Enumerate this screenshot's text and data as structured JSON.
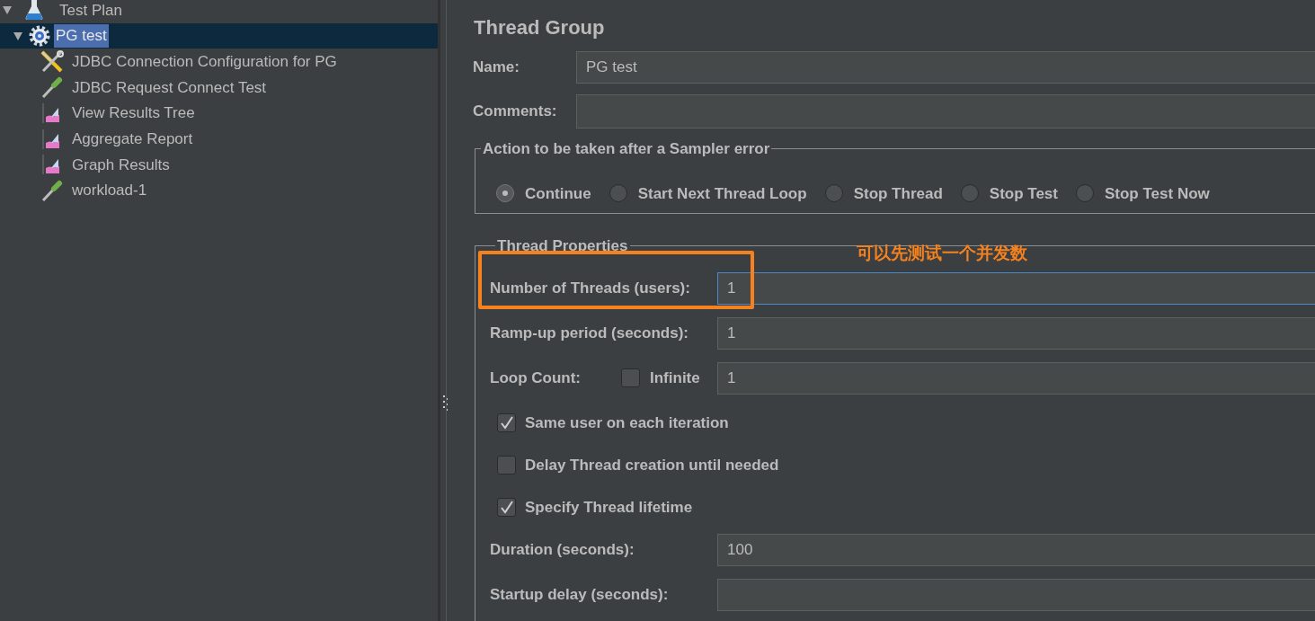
{
  "tree": [
    {
      "label": "Test Plan",
      "kind": "test-plan",
      "expanded": true,
      "selected": false,
      "children": [
        {
          "label": "PG test",
          "kind": "thread-group",
          "expanded": true,
          "selected": true,
          "children": [
            {
              "label": "JDBC Connection Configuration for PG",
              "kind": "config",
              "selected": false
            },
            {
              "label": "JDBC Request Connect Test",
              "kind": "sampler",
              "selected": false
            },
            {
              "label": "View Results Tree",
              "kind": "listener",
              "selected": false
            },
            {
              "label": "Aggregate Report",
              "kind": "listener",
              "selected": false
            },
            {
              "label": "Graph Results",
              "kind": "listener",
              "selected": false
            },
            {
              "label": "workload-1",
              "kind": "sampler",
              "selected": false
            }
          ]
        }
      ]
    }
  ],
  "panel": {
    "title": "Thread Group",
    "name": {
      "label": "Name:",
      "value": "PG test"
    },
    "comments": {
      "label": "Comments:"
    },
    "sampler_error": {
      "legend": "Action to be taken after a Sampler error",
      "options": [
        {
          "label": "Continue",
          "selected": true
        },
        {
          "label": "Start Next Thread Loop",
          "selected": false
        },
        {
          "label": "Stop Thread",
          "selected": false
        },
        {
          "label": "Stop Test",
          "selected": false
        },
        {
          "label": "Stop Test Now",
          "selected": false
        }
      ]
    },
    "thread_properties": {
      "legend": "Thread Properties",
      "rows": [
        {
          "kind": "field",
          "label": "Number of Threads (users):",
          "value": "1",
          "focused": true
        },
        {
          "kind": "field",
          "label": "Ramp-up period (seconds):",
          "value": "1",
          "focused": false
        },
        {
          "kind": "loop",
          "label": "Loop Count:",
          "checkbox_label": "Infinite",
          "checked": false,
          "value": "1",
          "focused": false
        },
        {
          "kind": "checkbox",
          "label": "Same user on each iteration",
          "checked": true
        },
        {
          "kind": "checkbox",
          "label": "Delay Thread creation until needed",
          "checked": false
        },
        {
          "kind": "checkbox",
          "label": "Specify Thread lifetime",
          "checked": true
        },
        {
          "kind": "field",
          "label": "Duration (seconds):",
          "value": "100",
          "focused": false
        },
        {
          "kind": "field",
          "label": "Startup delay (seconds):",
          "focused": false
        }
      ]
    }
  },
  "annotation": {
    "text": "可以先测试一个并发数"
  }
}
